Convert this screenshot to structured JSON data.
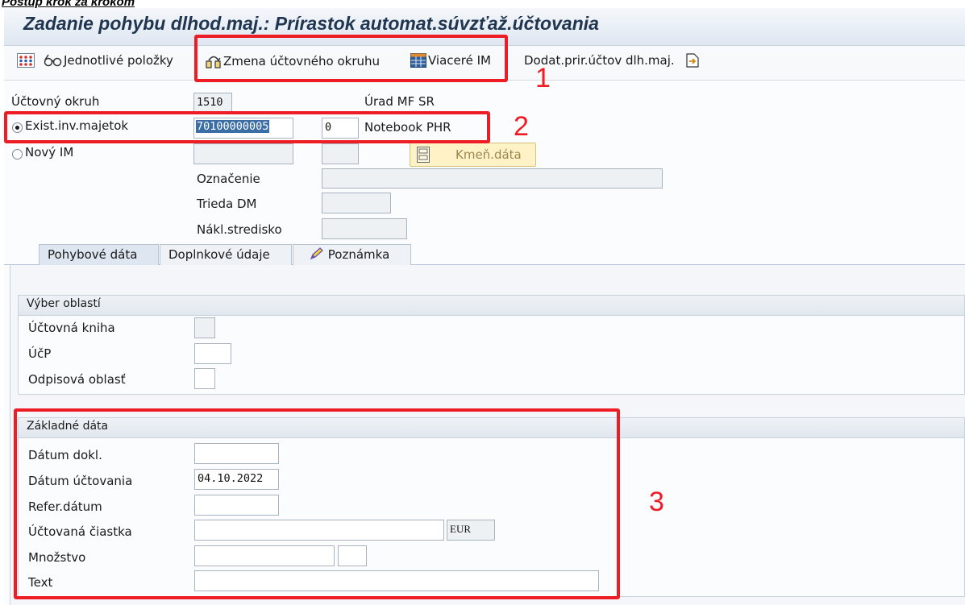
{
  "document_heading": "Postup krok za krokom",
  "window": {
    "title": "Zadanie pohybu dlhod.maj.: Prírastok automat.súvzťaž.účtovania"
  },
  "toolbar": {
    "items": [
      {
        "label": "Jednotlivé položky",
        "icon": "dots-grid-icon"
      },
      {
        "label": "Zmena účtovného okruhu",
        "icon": "change-company-code-icon"
      },
      {
        "label": "Viaceré IM",
        "icon": "table-grid-icon"
      },
      {
        "label": "Dodat.prir.účtov dlh.maj.",
        "icon": "document-arrow-icon"
      }
    ]
  },
  "header": {
    "company_code": {
      "label": "Účtovný okruh",
      "value": "1510",
      "description": "Úrad MF SR"
    },
    "existing_asset": {
      "label": "Exist.inv.majetok",
      "selected": true,
      "asset_number": "70100000005",
      "sub_number": "0",
      "description": "Notebook PHR"
    },
    "new_asset": {
      "label": "Nový IM",
      "selected": false
    },
    "master_data_button": {
      "label": "Kmeň.dáta",
      "icon": "master-data-icon"
    },
    "designation": {
      "label": "Označenie",
      "value": ""
    },
    "asset_class": {
      "label": "Trieda DM",
      "value": ""
    },
    "cost_center": {
      "label": "Nákl.stredisko",
      "value": ""
    }
  },
  "tabs": [
    {
      "label": "Pohybové dáta",
      "active": true
    },
    {
      "label": "Doplnkové údaje",
      "active": false
    },
    {
      "label": "Poznámka",
      "active": false,
      "icon": "pencil-note-icon"
    }
  ],
  "area_selection": {
    "title": "Výber oblastí",
    "fields": [
      {
        "label": "Účtovná kniha",
        "value": ""
      },
      {
        "label": "ÚčP",
        "value": ""
      },
      {
        "label": "Odpisová oblasť",
        "value": ""
      }
    ]
  },
  "basic_data": {
    "title": "Základné dáta",
    "document_date": {
      "label": "Dátum dokl.",
      "value": ""
    },
    "posting_date": {
      "label": "Dátum účtovania",
      "value": "04.10.2022"
    },
    "reference_date": {
      "label": "Refer.dátum",
      "value": ""
    },
    "amount": {
      "label": "Účtovaná čiastka",
      "value": "",
      "currency": "EUR"
    },
    "quantity": {
      "label": "Množstvo",
      "value": "",
      "unit": ""
    },
    "text": {
      "label": "Text",
      "value": ""
    }
  },
  "annotations": [
    "1",
    "2",
    "3"
  ],
  "colors": {
    "annotation_red": "#ee1c24",
    "title_text": "#1f3550",
    "selection_blue": "#3a6ea5"
  }
}
